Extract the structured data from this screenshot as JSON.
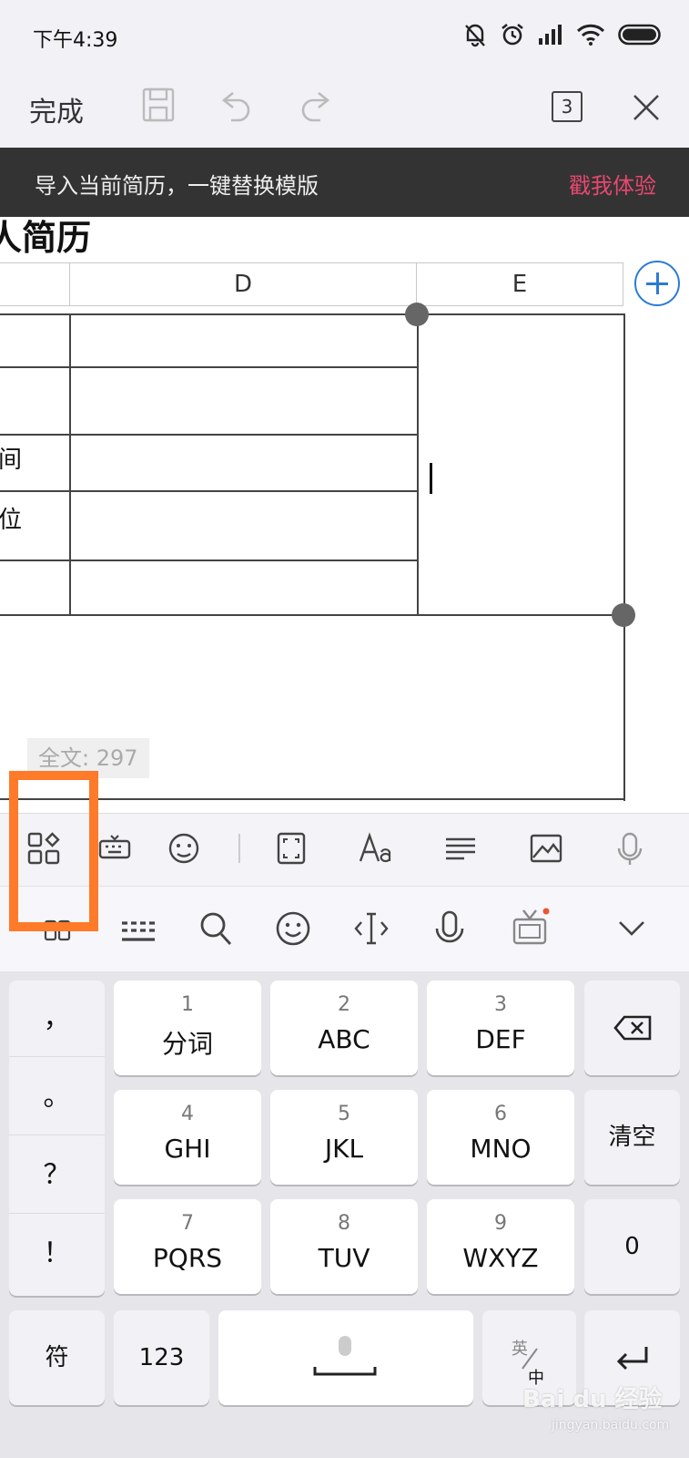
{
  "status_bar": {
    "time": "下午4:39",
    "icons": [
      "bell-muted-icon",
      "alarm-icon",
      "signal-icon",
      "wifi-icon",
      "battery-icon"
    ]
  },
  "toolbar": {
    "done_label": "完成",
    "page_count": "3",
    "icons": [
      "save-icon",
      "undo-icon",
      "redo-icon",
      "close-icon"
    ]
  },
  "banner": {
    "text": "导入当前简历，一键替换模版",
    "action": "戳我体验",
    "action_color": "#e8476f"
  },
  "document": {
    "title_fragment": "人简历",
    "columns": [
      "D",
      "E"
    ],
    "row_label_fragments": [
      "间",
      "位"
    ],
    "word_count": "全文: 297"
  },
  "edit_bar": {
    "icons": [
      "apps-grid-icon",
      "keyboard-icon",
      "emoji-face-icon",
      "fullscreen-icon",
      "font-icon",
      "align-icon",
      "image-icon",
      "microphone-icon"
    ]
  },
  "ime_bar": {
    "icons": [
      "grid-icon",
      "keyboard-icon",
      "search-icon",
      "smiley-icon",
      "cursor-move-icon",
      "voice-icon",
      "tv-icon",
      "collapse-icon"
    ]
  },
  "keyboard": {
    "punctuation": [
      "，",
      "。",
      "？",
      "！"
    ],
    "keys": [
      {
        "num": "1",
        "letters": "分词"
      },
      {
        "num": "2",
        "letters": "ABC"
      },
      {
        "num": "3",
        "letters": "DEF"
      },
      {
        "num": "4",
        "letters": "GHI"
      },
      {
        "num": "5",
        "letters": "JKL"
      },
      {
        "num": "6",
        "letters": "MNO"
      },
      {
        "num": "7",
        "letters": "PQRS"
      },
      {
        "num": "8",
        "letters": "TUV"
      },
      {
        "num": "9",
        "letters": "WXYZ"
      }
    ],
    "clear_label": "清空",
    "zero_label": "0",
    "symbol_label": "符",
    "number_label": "123",
    "lang_top": "英",
    "lang_bottom": "中"
  },
  "watermark": {
    "brand": "Bai du 经验",
    "url": "jingyan.baidu.com"
  },
  "highlight_color": "#ff7a29"
}
